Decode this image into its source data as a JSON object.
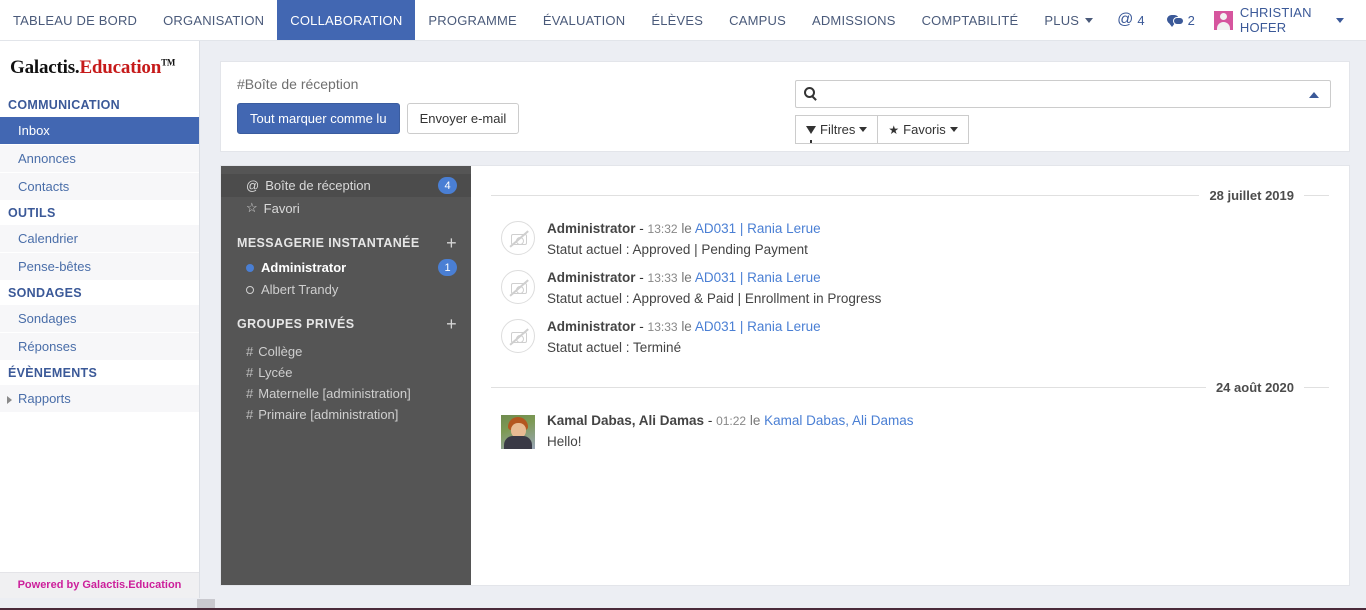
{
  "topnav": {
    "items": [
      {
        "label": "TABLEAU DE BORD",
        "active": false
      },
      {
        "label": "ORGANISATION",
        "active": false
      },
      {
        "label": "COLLABORATION",
        "active": true
      },
      {
        "label": "PROGRAMME",
        "active": false
      },
      {
        "label": "ÉVALUATION",
        "active": false
      },
      {
        "label": "ÉLÈVES",
        "active": false
      },
      {
        "label": "CAMPUS",
        "active": false
      },
      {
        "label": "ADMISSIONS",
        "active": false
      },
      {
        "label": "COMPTABILITÉ",
        "active": false
      },
      {
        "label": "PLUS",
        "active": false
      }
    ],
    "mentions_count": "4",
    "messages_count": "2",
    "user_name": "CHRISTIAN HOFER",
    "accent_active": "#4267b2",
    "link_color": "#3b5998"
  },
  "sidebar": {
    "brand_part1": "Galactis.",
    "brand_part2": "Education",
    "brand_tm": "TM",
    "groups": [
      {
        "title": "COMMUNICATION",
        "items": [
          {
            "label": "Inbox",
            "active": true,
            "arrow": false
          },
          {
            "label": "Annonces",
            "active": false,
            "arrow": false
          },
          {
            "label": "Contacts",
            "active": false,
            "arrow": false
          }
        ]
      },
      {
        "title": "OUTILS",
        "items": [
          {
            "label": "Calendrier",
            "active": false,
            "arrow": false
          },
          {
            "label": "Pense-bêtes",
            "active": false,
            "arrow": false
          }
        ]
      },
      {
        "title": "SONDAGES",
        "items": [
          {
            "label": "Sondages",
            "active": false,
            "arrow": false
          },
          {
            "label": "Réponses",
            "active": false,
            "arrow": false
          }
        ]
      },
      {
        "title": "ÉVÈNEMENTS",
        "items": [
          {
            "label": "Rapports",
            "active": false,
            "arrow": true
          }
        ]
      }
    ],
    "footer": "Powered by Galactis.Education",
    "footer_color": "#cc1f9b"
  },
  "toolbar": {
    "inbox_title": "#Boîte de réception",
    "mark_all_read_label": "Tout marquer comme lu",
    "send_email_label": "Envoyer e-mail",
    "search_value": "",
    "search_placeholder": "",
    "filters_label": "Filtres",
    "favorites_label": "Favoris"
  },
  "channels": {
    "top": [
      {
        "icon": "@",
        "label": "Boîte de réception",
        "badge": "4",
        "selected": true
      },
      {
        "icon": "☆",
        "label": "Favori",
        "badge": "",
        "selected": false
      }
    ],
    "im_header": "MESSAGERIE INSTANTANÉE",
    "users": [
      {
        "label": "Administrator",
        "online": true,
        "badge": "1"
      },
      {
        "label": "Albert Trandy",
        "online": false,
        "badge": ""
      }
    ],
    "groups_header": "GROUPES PRIVÉS",
    "groups": [
      {
        "label": "Collège"
      },
      {
        "label": "Lycée"
      },
      {
        "label": "Maternelle [administration]"
      },
      {
        "label": "Primaire [administration]"
      }
    ],
    "add_label": "+"
  },
  "messages": {
    "sections": [
      {
        "date": "28 juillet 2019",
        "items": [
          {
            "avatar": "placeholder",
            "author": "Administrator",
            "time": "13:32",
            "sep": "le",
            "target": "AD031 | Rania Lerue",
            "text": "Statut actuel : Approved | Pending Payment"
          },
          {
            "avatar": "placeholder",
            "author": "Administrator",
            "time": "13:33",
            "sep": "le",
            "target": "AD031 | Rania Lerue",
            "text": "Statut actuel : Approved & Paid | Enrollment in Progress"
          },
          {
            "avatar": "placeholder",
            "author": "Administrator",
            "time": "13:33",
            "sep": "le",
            "target": "AD031 | Rania Lerue",
            "text": "Statut actuel : Terminé"
          }
        ]
      },
      {
        "date": "24 août 2020",
        "items": [
          {
            "avatar": "photo",
            "author": "Kamal Dabas, Ali Damas",
            "time": "01:22",
            "sep": "le",
            "target": "Kamal Dabas, Ali Damas",
            "text": "Hello!"
          }
        ]
      }
    ]
  }
}
